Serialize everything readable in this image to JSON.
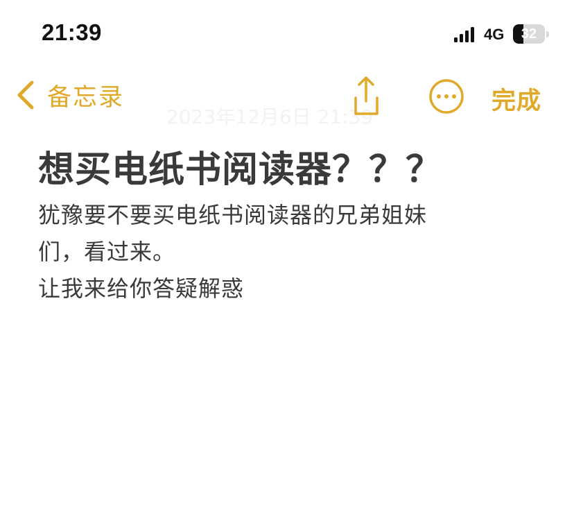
{
  "status_bar": {
    "time": "21:39",
    "network": "4G",
    "battery_percent": "32",
    "battery_level": 0.32
  },
  "nav": {
    "back_label": "备忘录",
    "done_label": "完成",
    "faded_date": "2023年12月6日 21:39"
  },
  "note": {
    "title": "想买电纸书阅读器？？？",
    "lines": [
      "犹豫要不要买电纸书阅读器的兄弟姐妹",
      "们，看过来。",
      "让我来给你答疑解惑"
    ]
  },
  "icons": {
    "back": "chevron-left-icon",
    "share": "share-icon",
    "more": "ellipsis-circle-icon",
    "signal": "cellular-signal-icon",
    "battery": "battery-icon"
  },
  "colors": {
    "accent": "#e0a92a",
    "text": "#3a3a3a",
    "background": "#ffffff"
  }
}
